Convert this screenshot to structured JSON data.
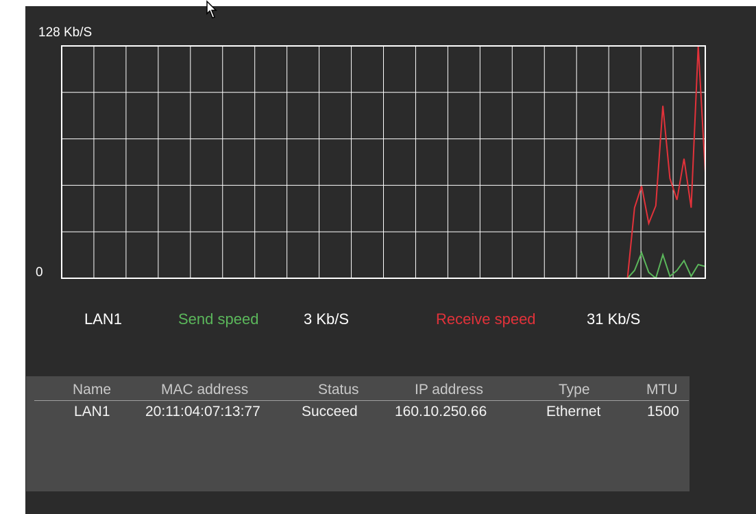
{
  "chart": {
    "max_label": "128 Kb/S",
    "zero_label": "0",
    "colors": {
      "grid": "#ffffff",
      "send": "#5bb75b",
      "receive": "#e2323a"
    }
  },
  "chart_data": {
    "type": "line",
    "y_max_kbps": 128,
    "ylim": [
      0,
      128
    ],
    "grid": true,
    "series": [
      {
        "name": "Send speed",
        "color": "#5bb75b",
        "values": [
          0,
          0,
          0,
          0,
          0,
          0,
          0,
          0,
          0,
          0,
          0,
          0,
          0,
          0,
          0,
          0,
          0,
          0,
          0,
          0,
          0,
          0,
          0,
          0,
          0,
          0,
          0,
          0,
          0,
          0,
          0,
          0,
          0,
          0,
          0,
          0,
          0,
          0,
          0,
          0,
          0,
          0,
          0,
          0,
          0,
          0,
          0,
          0,
          0,
          0,
          0,
          0,
          0,
          0,
          0,
          0,
          0,
          0,
          0,
          0,
          0,
          0,
          0,
          0,
          0,
          0,
          0,
          0,
          0,
          0,
          0,
          0,
          0,
          0,
          0,
          0,
          0,
          0,
          0,
          0,
          0,
          4,
          13,
          3,
          0,
          12,
          1,
          4,
          9,
          1,
          7,
          6
        ]
      },
      {
        "name": "Receive speed",
        "color": "#e2323a",
        "values": [
          0,
          0,
          0,
          0,
          0,
          0,
          0,
          0,
          0,
          0,
          0,
          0,
          0,
          0,
          0,
          0,
          0,
          0,
          0,
          0,
          0,
          0,
          0,
          0,
          0,
          0,
          0,
          0,
          0,
          0,
          0,
          0,
          0,
          0,
          0,
          0,
          0,
          0,
          0,
          0,
          0,
          0,
          0,
          0,
          0,
          0,
          0,
          0,
          0,
          0,
          0,
          0,
          0,
          0,
          0,
          0,
          0,
          0,
          0,
          0,
          0,
          0,
          0,
          0,
          0,
          0,
          0,
          0,
          0,
          0,
          0,
          0,
          0,
          0,
          0,
          0,
          0,
          0,
          0,
          0,
          0,
          36,
          47,
          28,
          37,
          88,
          51,
          40,
          61,
          36,
          136,
          54
        ]
      }
    ]
  },
  "legend": {
    "interface": "LAN1",
    "send_label": "Send speed",
    "send_value": "3 Kb/S",
    "receive_label": "Receive speed",
    "receive_value": "31 Kb/S"
  },
  "table": {
    "headers": [
      "Name",
      "MAC address",
      "Status",
      "IP address",
      "Type",
      "MTU"
    ],
    "rows": [
      [
        "LAN1",
        "20:11:04:07:13:77",
        "Succeed",
        "160.10.250.66",
        "Ethernet",
        "1500"
      ]
    ]
  }
}
